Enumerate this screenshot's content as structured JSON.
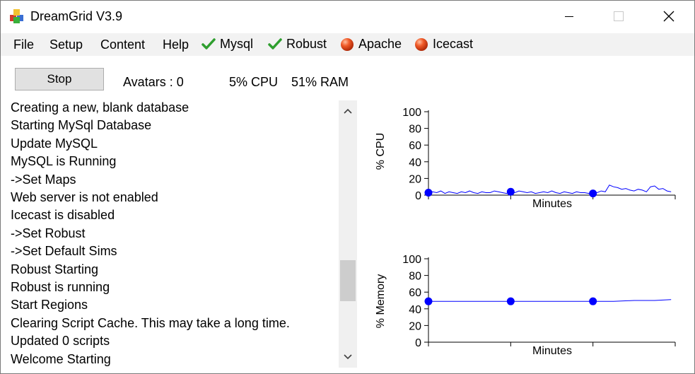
{
  "window": {
    "title": "DreamGrid V3.9"
  },
  "menu": {
    "items": [
      "File",
      "Setup",
      "Content",
      "Help"
    ]
  },
  "services": [
    {
      "label": "Mysql",
      "state": "running",
      "icon": "green-check-icon",
      "color": "#2e9e2e"
    },
    {
      "label": "Robust",
      "state": "running",
      "icon": "green-check-icon",
      "color": "#2e9e2e"
    },
    {
      "label": "Apache",
      "state": "stopped",
      "icon": "red-ball-icon",
      "color": "#e0401a"
    },
    {
      "label": "Icecast",
      "state": "stopped",
      "icon": "red-ball-icon",
      "color": "#e0401a"
    }
  ],
  "controls": {
    "stop_label": "Stop",
    "avatars": "Avatars : 0",
    "cpu": "5% CPU",
    "ram": "51% RAM"
  },
  "log": [
    "Creating a new, blank database",
    "Starting MySql Database",
    "Update MySQL",
    "MySQL is Running",
    "->Set Maps",
    "Web server is not enabled",
    "Icecast is disabled",
    "->Set Robust",
    "->Set Default Sims",
    "Robust Starting",
    "Robust is running",
    "Start Regions",
    "Clearing Script Cache. This may take a long time.",
    "Updated 0 scripts",
    "Welcome Starting"
  ],
  "scroll": {
    "thumb_position_fraction": 0.62
  },
  "chart_data": [
    {
      "type": "line",
      "ylabel": "% CPU",
      "xlabel": "Minutes",
      "ylim": [
        0,
        100
      ],
      "yticks": [
        "100",
        "80",
        "60",
        "40",
        "20",
        "0"
      ],
      "grid": false,
      "color": "#0000ff",
      "x": [
        0,
        1,
        2,
        3,
        4,
        5,
        6,
        7,
        8,
        9,
        10,
        11,
        12,
        13,
        14,
        15,
        16,
        17,
        18,
        19,
        20,
        21,
        22,
        23,
        24,
        25,
        26,
        27,
        28,
        29,
        30,
        31,
        32,
        33,
        34,
        35,
        36,
        37,
        38,
        39,
        40,
        41,
        42,
        43,
        44,
        45,
        46,
        47,
        48,
        49,
        50,
        51,
        52,
        53,
        54,
        55,
        56,
        57,
        58,
        59
      ],
      "values": [
        3,
        4,
        3,
        5,
        2,
        4,
        3,
        2,
        4,
        3,
        5,
        3,
        2,
        4,
        3,
        3,
        5,
        4,
        3,
        2,
        4,
        3,
        5,
        4,
        3,
        4,
        2,
        3,
        4,
        3,
        5,
        3,
        2,
        4,
        3,
        2,
        4,
        3,
        3,
        2,
        4,
        3,
        5,
        4,
        12,
        10,
        9,
        7,
        8,
        6,
        5,
        7,
        6,
        4,
        10,
        11,
        7,
        8,
        5,
        4
      ],
      "markers_x": [
        0,
        20,
        40
      ],
      "markers_y": [
        3,
        4,
        2
      ]
    },
    {
      "type": "line",
      "ylabel": "% Memory",
      "xlabel": "Minutes",
      "ylim": [
        0,
        100
      ],
      "yticks": [
        "100",
        "80",
        "60",
        "40",
        "20",
        "0"
      ],
      "grid": false,
      "color": "#0000ff",
      "x": [
        0,
        5,
        10,
        15,
        20,
        25,
        30,
        35,
        40,
        45,
        50,
        55,
        59
      ],
      "values": [
        49,
        49,
        49,
        49,
        49,
        49,
        49,
        49,
        49,
        49,
        50,
        50,
        51
      ],
      "markers_x": [
        0,
        20,
        40
      ],
      "markers_y": [
        49,
        49,
        49
      ]
    }
  ]
}
